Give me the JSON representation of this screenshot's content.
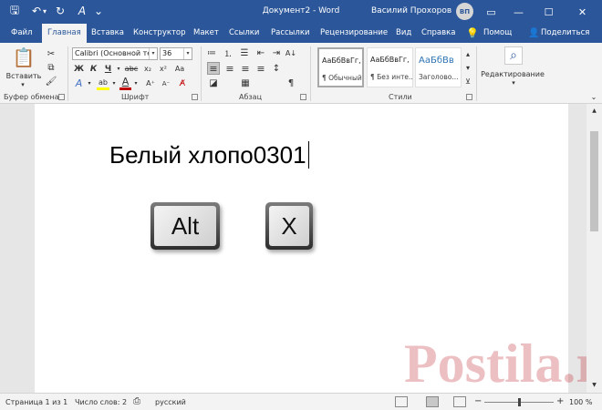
{
  "titlebar": {
    "doc_title": "Документ2  -  Word",
    "user_name": "Василий Прохоров",
    "avatar_initials": "ВП",
    "icons": [
      "save-icon",
      "undo-icon",
      "redo-icon",
      "autoformat-icon",
      "customize-qat-icon",
      "ribbon-display-icon",
      "minimize-icon",
      "maximize-icon",
      "close-icon"
    ],
    "glyphs": {
      "save": "🖫",
      "undo": "↶",
      "dd": "▾",
      "redo": "↻",
      "autoformat": "A",
      "qat": "⌄",
      "ribbon": "▭",
      "min": "—",
      "max": "☐",
      "close": "✕"
    }
  },
  "tabs": [
    "Файл",
    "Главная",
    "Вставка",
    "Конструктор",
    "Макет",
    "Ссылки",
    "Рассылки",
    "Рецензирование",
    "Вид",
    "Справка"
  ],
  "tabs_right": {
    "help_label": "Помощ",
    "share_label": "Поделиться",
    "lightbulb": "💡",
    "person": "👤"
  },
  "ribbon": {
    "clipboard": {
      "label": "Буфер обмена",
      "paste_label": "Вставить",
      "paste_icon": "📋",
      "cut": "✂",
      "copy": "⧉",
      "painter": "🖌"
    },
    "font": {
      "label": "Шрифт",
      "font_name": "Calibri (Основной тек",
      "font_size": "36",
      "grow": "A⁺",
      "shrink": "A⁻",
      "case": "Aa",
      "clear": "A̸",
      "bold": "Ж",
      "italic": "К",
      "underline": "Ч",
      "strike": "abc",
      "sub": "x₂",
      "sup": "x²",
      "effects": "A",
      "highlight": "ab",
      "fontcolor": "A",
      "arrow": "▾"
    },
    "paragraph": {
      "label": "Абзац",
      "bullets": "≔",
      "numbering": "⒈",
      "multilevel": "☰",
      "outdent": "⇤",
      "indent": "⇥",
      "sort": "A↓",
      "marks": "¶",
      "align_left": "≡",
      "align_center": "≡",
      "align_right": "≡",
      "justify": "≡",
      "spacing": "↕",
      "shading": "◪",
      "borders": "▦"
    },
    "styles": {
      "label": "Стили",
      "items": [
        {
          "preview": "АаБбВвГг,",
          "name": "¶ Обычный"
        },
        {
          "preview": "АаБбВвГг,",
          "name": "¶ Без инте..."
        },
        {
          "preview": "АаБбВв",
          "name": "Заголово..."
        }
      ],
      "scroll_up": "▴",
      "scroll_down": "▾",
      "more": "⊻"
    },
    "editing": {
      "label": "Редактирование",
      "icon": "⌕",
      "arrow": "▾"
    }
  },
  "document": {
    "text": "Белый хлопо0301",
    "key_alt": "Alt",
    "plus": "+",
    "key_x": "X",
    "watermark": "Postila.ru"
  },
  "scrollbar": {
    "up": "▲",
    "down": "▼"
  },
  "statusbar": {
    "page": "Страница 1 из 1",
    "words": "Число слов: 2",
    "proof_icon": "⎙",
    "language": "русский",
    "zoom_minus": "−",
    "zoom_plus": "+",
    "zoom": "100 %",
    "zoom_level": 1.0
  },
  "colors": {
    "accent": "#2b579a",
    "fontcolor_bar": "#c00000",
    "highlight_bar": "#ffff00",
    "effects_bar": "#4472c4"
  }
}
